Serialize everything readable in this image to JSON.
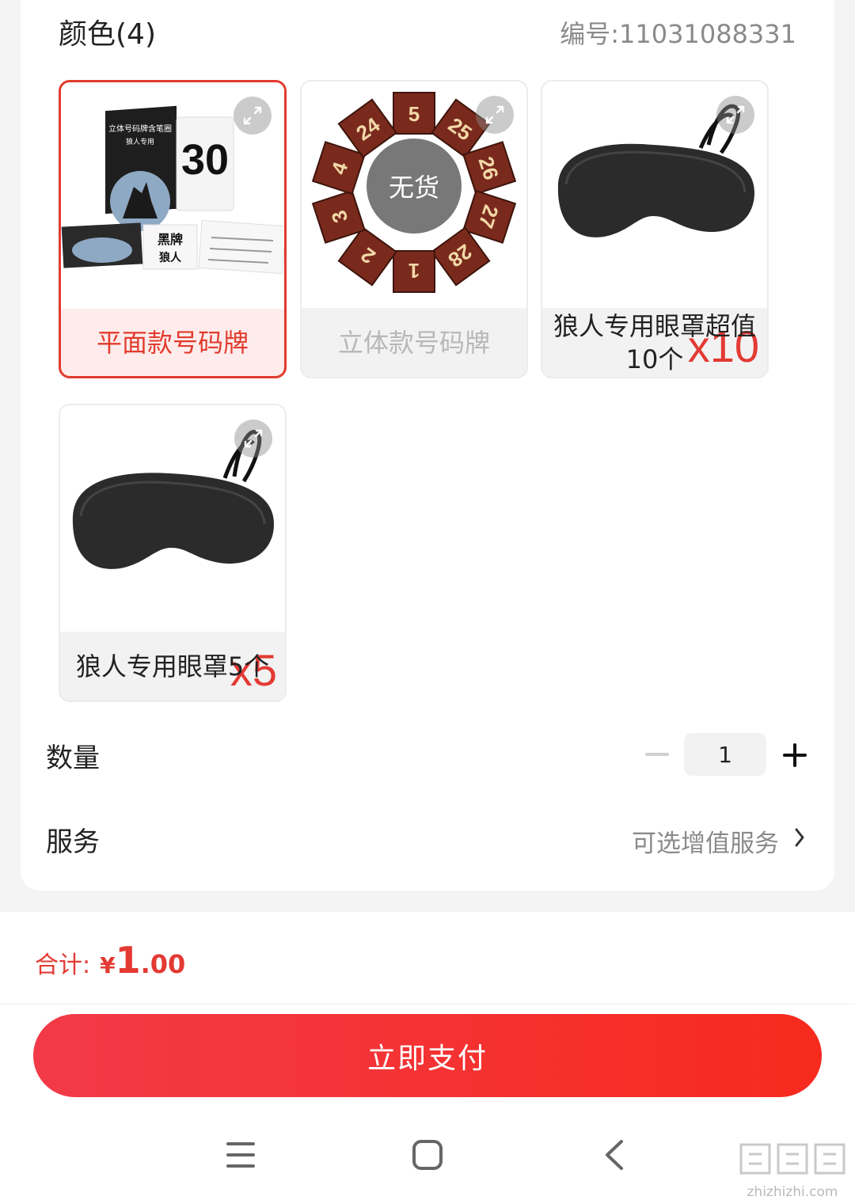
{
  "header": {
    "section_title": "颜色(4)",
    "sku_code": "编号:11031088331"
  },
  "options": [
    {
      "label": "平面款号码牌",
      "state": "selected",
      "image": "werewolf-number-cards",
      "card_title": "立体号码牌含笔圈",
      "card_sub": "狼人专用",
      "card_number": "30",
      "card_black": "黑牌",
      "card_wolf": "狼人"
    },
    {
      "label": "立体款号码牌",
      "state": "sold-out",
      "image": "3d-number-cubes",
      "soldout_text": "无货",
      "cube_numbers": [
        "5",
        "25",
        "26",
        "27",
        "28",
        "1",
        "2",
        "3",
        "4",
        "24"
      ]
    },
    {
      "label": "狼人专用眼罩超值10个",
      "state": "normal",
      "image": "eye-mask",
      "badge": "x10"
    },
    {
      "label": "狼人专用眼罩5个",
      "state": "normal",
      "image": "eye-mask",
      "badge": "x5"
    }
  ],
  "quantity": {
    "label": "数量",
    "value": "1"
  },
  "service": {
    "label": "服务",
    "value": "可选增值服务"
  },
  "footer": {
    "total_label": "合计:",
    "currency": "¥",
    "price_int": "1",
    "price_dec": ".00",
    "pay_button": "立即支付"
  },
  "watermark": {
    "site": "zhizhizhi.com"
  },
  "colors": {
    "accent": "#e33a33",
    "button": "#f5302f",
    "muted": "#8a8a8a"
  }
}
